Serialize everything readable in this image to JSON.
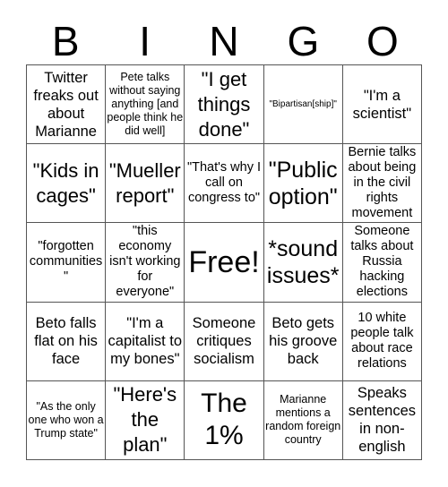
{
  "title_letters": [
    "B",
    "I",
    "N",
    "G",
    "O"
  ],
  "cells": [
    "Twitter freaks out about Marianne",
    "Pete talks without saying anything [and people think he did well]",
    "\"I get things done\"",
    "\"Bipartisan[ship]\"",
    "\"I'm a scientist\"",
    "\"Kids in cages\"",
    "\"Mueller report\"",
    "\"That's why I call on congress to\"",
    "\"Public option\"",
    "Bernie talks about being in the civil rights movement",
    "\"forgotten communities\"",
    "\"this economy isn't working for everyone\"",
    "Free!",
    "*sound issues*",
    "Someone talks about Russia hacking elections",
    "Beto falls flat on his face",
    "\"I'm a capitalist to my bones\"",
    "Someone critiques socialism",
    "Beto gets his groove back",
    "10 white people talk about race relations",
    "\"As the only one who won a Trump state\"",
    "\"Here's the plan\"",
    "The 1%",
    "Marianne mentions a random foreign country",
    "Speaks sentences in non-english"
  ]
}
